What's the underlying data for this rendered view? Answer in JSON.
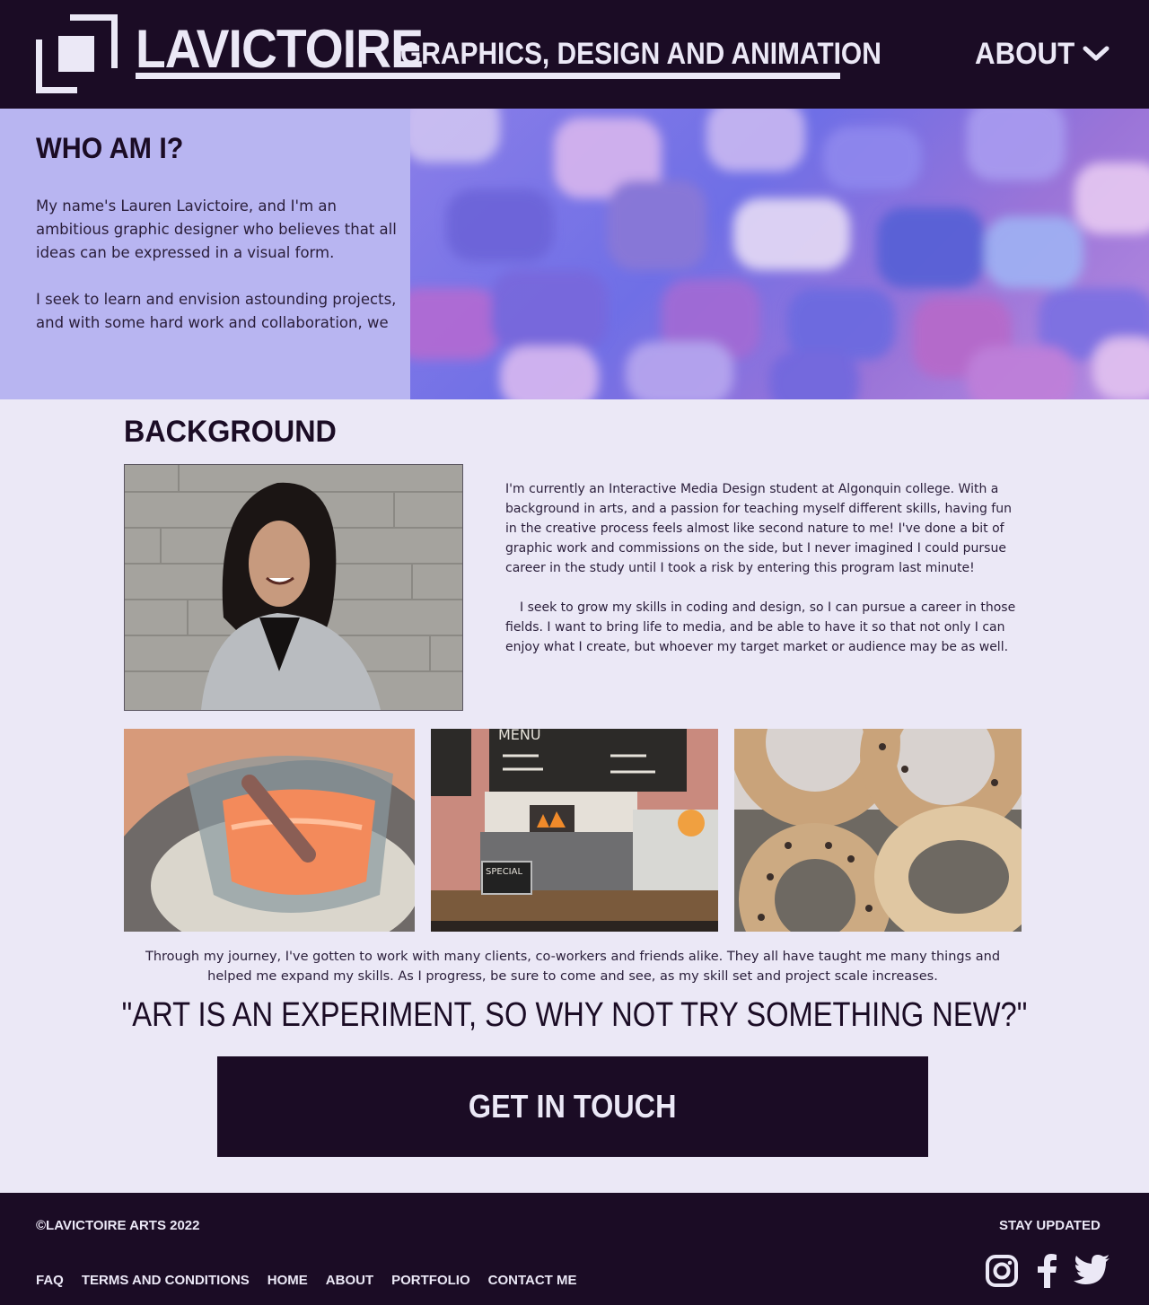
{
  "header": {
    "brand": "LAVICTOIRE",
    "tagline": "GRAPHICS, DESIGN AND ANIMATION",
    "nav_about": "ABOUT",
    "logo_icon": "logo-square-mark",
    "nav_icon": "chevron-down-icon"
  },
  "hero": {
    "heading": "WHO AM I?",
    "paragraphs": [
      "My name's Lauren Lavictoire, and I'm an ambitious graphic designer who believes that all ideas can be expressed in a visual form.",
      "I seek to learn and envision astounding projects, and with some hard work and collaboration, we"
    ]
  },
  "background": {
    "heading": "BACKGROUND",
    "paragraphs": [
      "I'm currently an Interactive Media Design student at Algonquin college. With a background in arts, and a passion for teaching myself different skills, having fun in the creative process feels almost like second nature to me! I've done a bit of graphic work and commissions on the side, but I never imagined I could pursue career in the study until I took a risk by entering this program last minute!",
      "I seek to grow my skills in coding and design, so I can pursue a career in those fields. I want to bring life to media, and be able to have it so that not only I can enjoy what I create, but whoever my target market or audience may be as well."
    ],
    "artwork_menu_text": "MENU",
    "artwork_special_text": "SPECIAL"
  },
  "journey": "Through my journey, I've gotten to work with many clients, co-workers and friends alike. They all have taught me many things and helped me expand my skills. As I progress, be sure to come and see, as my skill set and project scale increases.",
  "quote": "\"ART IS AN EXPERIMENT, SO WHY NOT TRY SOMETHING NEW?\"",
  "cta": "GET IN TOUCH",
  "footer": {
    "copyright": "©LAVICTOIRE ARTS 2022",
    "stay_updated": "STAY UPDATED",
    "links": [
      "FAQ",
      "TERMS AND CONDITIONS",
      "HOME",
      "ABOUT",
      "PORTFOLIO",
      "CONTACT ME"
    ],
    "social_icons": [
      "instagram-icon",
      "facebook-icon",
      "twitter-icon"
    ]
  },
  "colors": {
    "dark": "#1b0c25",
    "light": "#ebe8f6",
    "lavender": "#b8b5f1"
  }
}
